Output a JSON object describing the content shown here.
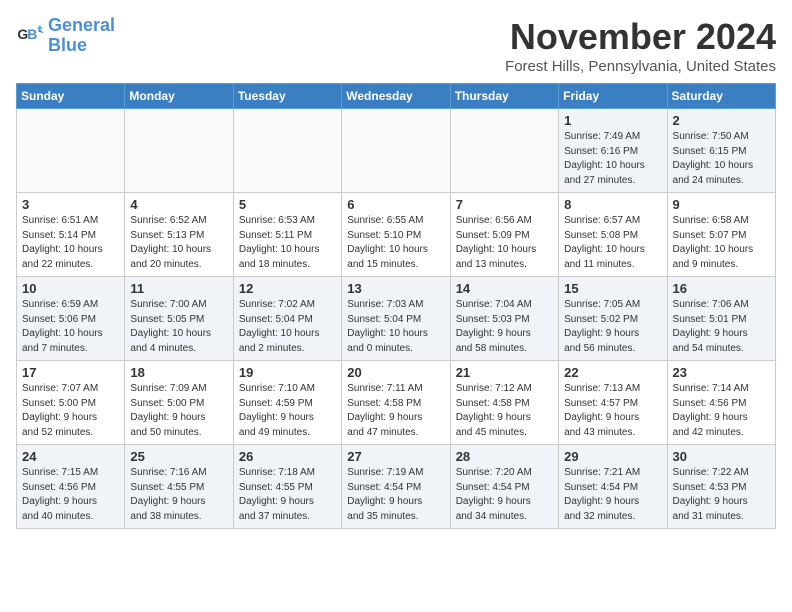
{
  "logo": {
    "line1": "General",
    "line2": "Blue"
  },
  "title": "November 2024",
  "location": "Forest Hills, Pennsylvania, United States",
  "weekdays": [
    "Sunday",
    "Monday",
    "Tuesday",
    "Wednesday",
    "Thursday",
    "Friday",
    "Saturday"
  ],
  "weeks": [
    [
      {
        "day": "",
        "info": ""
      },
      {
        "day": "",
        "info": ""
      },
      {
        "day": "",
        "info": ""
      },
      {
        "day": "",
        "info": ""
      },
      {
        "day": "",
        "info": ""
      },
      {
        "day": "1",
        "info": "Sunrise: 7:49 AM\nSunset: 6:16 PM\nDaylight: 10 hours\nand 27 minutes."
      },
      {
        "day": "2",
        "info": "Sunrise: 7:50 AM\nSunset: 6:15 PM\nDaylight: 10 hours\nand 24 minutes."
      }
    ],
    [
      {
        "day": "3",
        "info": "Sunrise: 6:51 AM\nSunset: 5:14 PM\nDaylight: 10 hours\nand 22 minutes."
      },
      {
        "day": "4",
        "info": "Sunrise: 6:52 AM\nSunset: 5:13 PM\nDaylight: 10 hours\nand 20 minutes."
      },
      {
        "day": "5",
        "info": "Sunrise: 6:53 AM\nSunset: 5:11 PM\nDaylight: 10 hours\nand 18 minutes."
      },
      {
        "day": "6",
        "info": "Sunrise: 6:55 AM\nSunset: 5:10 PM\nDaylight: 10 hours\nand 15 minutes."
      },
      {
        "day": "7",
        "info": "Sunrise: 6:56 AM\nSunset: 5:09 PM\nDaylight: 10 hours\nand 13 minutes."
      },
      {
        "day": "8",
        "info": "Sunrise: 6:57 AM\nSunset: 5:08 PM\nDaylight: 10 hours\nand 11 minutes."
      },
      {
        "day": "9",
        "info": "Sunrise: 6:58 AM\nSunset: 5:07 PM\nDaylight: 10 hours\nand 9 minutes."
      }
    ],
    [
      {
        "day": "10",
        "info": "Sunrise: 6:59 AM\nSunset: 5:06 PM\nDaylight: 10 hours\nand 7 minutes."
      },
      {
        "day": "11",
        "info": "Sunrise: 7:00 AM\nSunset: 5:05 PM\nDaylight: 10 hours\nand 4 minutes."
      },
      {
        "day": "12",
        "info": "Sunrise: 7:02 AM\nSunset: 5:04 PM\nDaylight: 10 hours\nand 2 minutes."
      },
      {
        "day": "13",
        "info": "Sunrise: 7:03 AM\nSunset: 5:04 PM\nDaylight: 10 hours\nand 0 minutes."
      },
      {
        "day": "14",
        "info": "Sunrise: 7:04 AM\nSunset: 5:03 PM\nDaylight: 9 hours\nand 58 minutes."
      },
      {
        "day": "15",
        "info": "Sunrise: 7:05 AM\nSunset: 5:02 PM\nDaylight: 9 hours\nand 56 minutes."
      },
      {
        "day": "16",
        "info": "Sunrise: 7:06 AM\nSunset: 5:01 PM\nDaylight: 9 hours\nand 54 minutes."
      }
    ],
    [
      {
        "day": "17",
        "info": "Sunrise: 7:07 AM\nSunset: 5:00 PM\nDaylight: 9 hours\nand 52 minutes."
      },
      {
        "day": "18",
        "info": "Sunrise: 7:09 AM\nSunset: 5:00 PM\nDaylight: 9 hours\nand 50 minutes."
      },
      {
        "day": "19",
        "info": "Sunrise: 7:10 AM\nSunset: 4:59 PM\nDaylight: 9 hours\nand 49 minutes."
      },
      {
        "day": "20",
        "info": "Sunrise: 7:11 AM\nSunset: 4:58 PM\nDaylight: 9 hours\nand 47 minutes."
      },
      {
        "day": "21",
        "info": "Sunrise: 7:12 AM\nSunset: 4:58 PM\nDaylight: 9 hours\nand 45 minutes."
      },
      {
        "day": "22",
        "info": "Sunrise: 7:13 AM\nSunset: 4:57 PM\nDaylight: 9 hours\nand 43 minutes."
      },
      {
        "day": "23",
        "info": "Sunrise: 7:14 AM\nSunset: 4:56 PM\nDaylight: 9 hours\nand 42 minutes."
      }
    ],
    [
      {
        "day": "24",
        "info": "Sunrise: 7:15 AM\nSunset: 4:56 PM\nDaylight: 9 hours\nand 40 minutes."
      },
      {
        "day": "25",
        "info": "Sunrise: 7:16 AM\nSunset: 4:55 PM\nDaylight: 9 hours\nand 38 minutes."
      },
      {
        "day": "26",
        "info": "Sunrise: 7:18 AM\nSunset: 4:55 PM\nDaylight: 9 hours\nand 37 minutes."
      },
      {
        "day": "27",
        "info": "Sunrise: 7:19 AM\nSunset: 4:54 PM\nDaylight: 9 hours\nand 35 minutes."
      },
      {
        "day": "28",
        "info": "Sunrise: 7:20 AM\nSunset: 4:54 PM\nDaylight: 9 hours\nand 34 minutes."
      },
      {
        "day": "29",
        "info": "Sunrise: 7:21 AM\nSunset: 4:54 PM\nDaylight: 9 hours\nand 32 minutes."
      },
      {
        "day": "30",
        "info": "Sunrise: 7:22 AM\nSunset: 4:53 PM\nDaylight: 9 hours\nand 31 minutes."
      }
    ]
  ]
}
